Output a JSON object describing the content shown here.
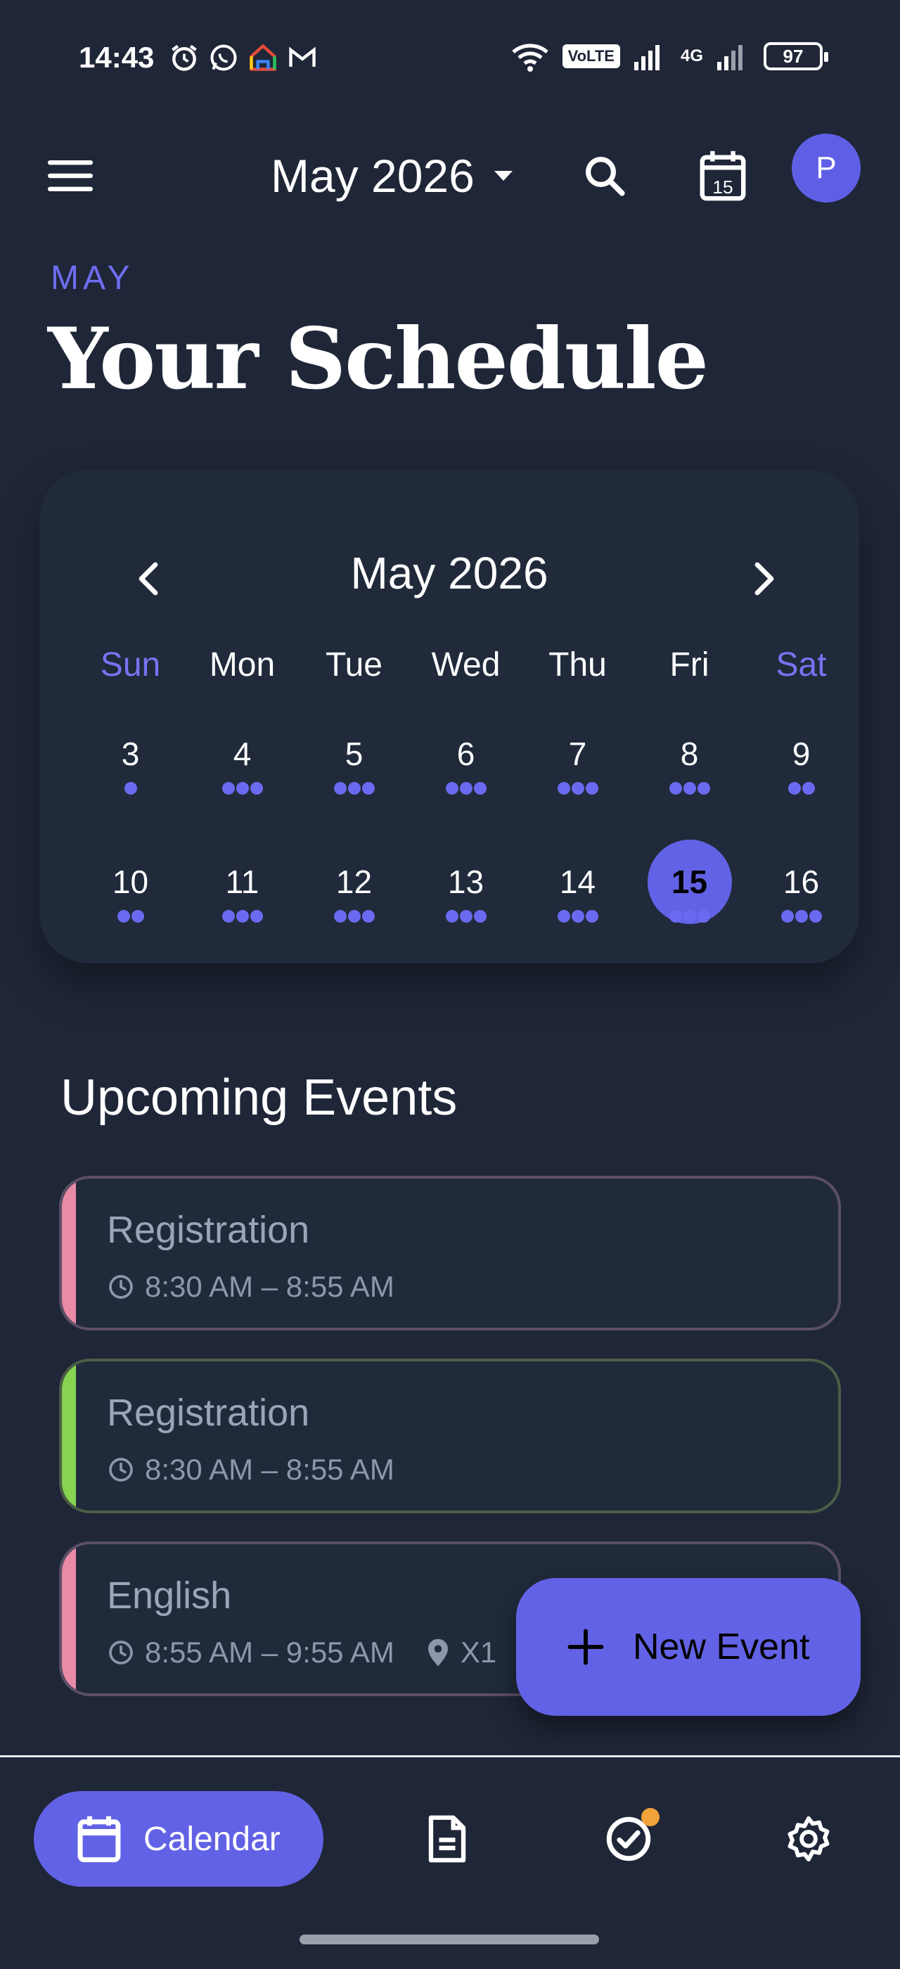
{
  "status": {
    "time": "14:43",
    "volte": "VoLTE",
    "network": "4G",
    "battery": "97"
  },
  "app_bar": {
    "month": "May 2026",
    "avatar_initial": "P"
  },
  "header": {
    "overline": "MAY",
    "title": "Your Schedule"
  },
  "calendar": {
    "title": "May 2026",
    "weekdays": [
      "Sun",
      "Mon",
      "Tue",
      "Wed",
      "Thu",
      "Fri",
      "Sat"
    ],
    "weeks": [
      [
        {
          "day": "3",
          "dots": 1
        },
        {
          "day": "4",
          "dots": 3
        },
        {
          "day": "5",
          "dots": 3
        },
        {
          "day": "6",
          "dots": 3
        },
        {
          "day": "7",
          "dots": 3
        },
        {
          "day": "8",
          "dots": 3
        },
        {
          "day": "9",
          "dots": 2
        }
      ],
      [
        {
          "day": "10",
          "dots": 2
        },
        {
          "day": "11",
          "dots": 3
        },
        {
          "day": "12",
          "dots": 3
        },
        {
          "day": "13",
          "dots": 3
        },
        {
          "day": "14",
          "dots": 3
        },
        {
          "day": "15",
          "dots": 3,
          "selected": true
        },
        {
          "day": "16",
          "dots": 3
        }
      ]
    ]
  },
  "upcoming": {
    "title": "Upcoming Events",
    "events": [
      {
        "title": "Registration",
        "time": "8:30 AM – 8:55 AM",
        "location": "",
        "stripe": "#e98aa7",
        "border": "#5b4f66"
      },
      {
        "title": "Registration",
        "time": "8:30 AM – 8:55 AM",
        "location": "",
        "stripe": "#86d451",
        "border": "#4b5e46"
      },
      {
        "title": "English",
        "time": "8:55 AM – 9:55 AM",
        "location": "X1",
        "stripe": "#e98aa7",
        "border": "#5b4f66"
      }
    ]
  },
  "fab": {
    "label": "New Event"
  },
  "bottom_nav": {
    "calendar_label": "Calendar"
  },
  "colors": {
    "background": "#1f2637",
    "accent": "#6262e6",
    "badge": "#f2a33a"
  }
}
